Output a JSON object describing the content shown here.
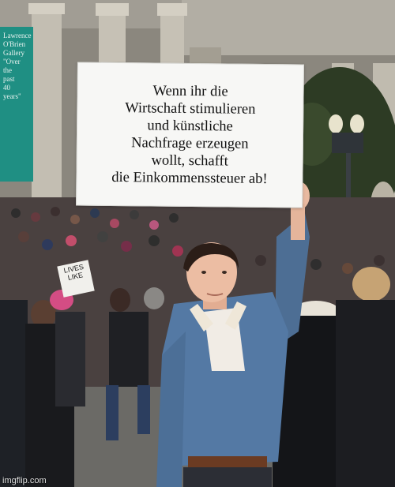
{
  "sign": {
    "text": "Wenn ihr die\nWirtschaft stimulieren\nund künstliche\nNachfrage erzeugen\nwollt, schafft\ndie Einkommenssteuer ab!"
  },
  "background": {
    "banner_text": "Lawrence\nO'Brien\nGallery\n\"Over\nthe\npast\n40\nyears\""
  },
  "crowd_signs": {
    "left_sign": "LIVES\nLIKE"
  },
  "watermark": "imgflip.com"
}
